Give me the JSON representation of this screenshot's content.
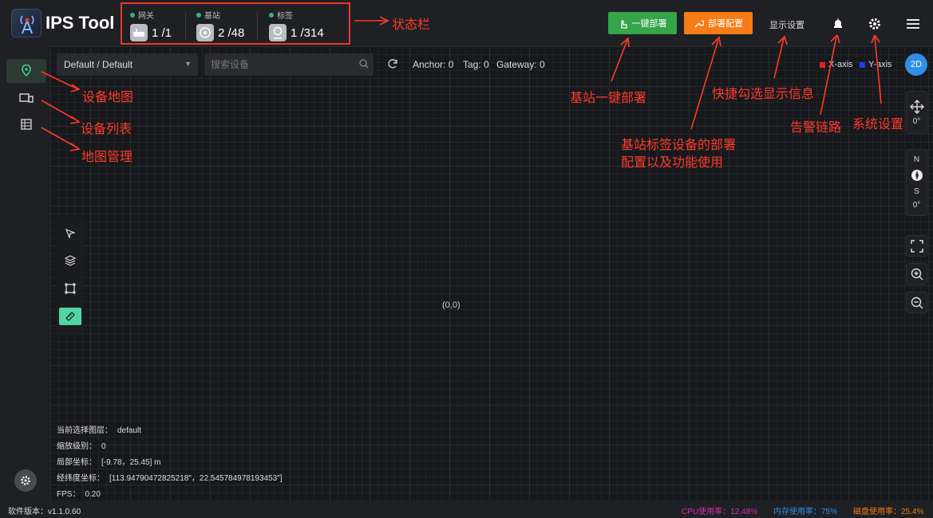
{
  "app": {
    "title": "IPS Tool"
  },
  "status": {
    "gateway": {
      "label": "网关",
      "value": "1 /1"
    },
    "anchor": {
      "label": "基站",
      "value": "2 /48"
    },
    "tag": {
      "label": "标签",
      "value": "1 /314"
    }
  },
  "toolbar": {
    "deploy_label": "一键部署",
    "config_label": "部署配置",
    "display_label": "显示设置",
    "icons": [
      "alarm-icon",
      "gear-icon",
      "menu-icon"
    ]
  },
  "annotations": {
    "status_bar": "状态栏",
    "device_map": "设备地图",
    "device_list": "设备列表",
    "map_manage": "地图管理",
    "one_click": "基站一键部署",
    "display": "快捷勾选显示信息",
    "config_line1": "基站标签设备的部署",
    "config_line2": "配置以及功能使用",
    "alarm": "告警链路",
    "system": "系统设置"
  },
  "filter": {
    "layer": "Default / Default",
    "search_placeholder": "搜索设备"
  },
  "counts": {
    "anchor": "Anchor: 0",
    "tag": "Tag: 0",
    "gateway": "Gateway: 0"
  },
  "axes": {
    "x_label": "X-axis",
    "x_color": "#e8231d",
    "y_label": "Y-axis",
    "y_color": "#1a3ff0",
    "mode": "2D"
  },
  "compass": {
    "rotate": "0°",
    "north": "N",
    "south": "S",
    "heading": "0°"
  },
  "canvas": {
    "origin": "(0,0)"
  },
  "info": {
    "layer_label": "当前选择图层：",
    "layer_value": "default",
    "zoom_label": "缩放级别：",
    "zoom_value": "0",
    "local_label": "局部坐标：",
    "local_value": "[-9.78，25.45] m",
    "geo_label": "经纬度坐标：",
    "geo_value": "[113.94790472825218\"，22.545784978193453\"]",
    "fps_label": "FPS：",
    "fps_value": "0.20"
  },
  "footer": {
    "version": "软件版本：v1.1.0.60",
    "cpu": "CPU使用率：12.48%",
    "cpu_color": "#d62fb2",
    "mem": "内存使用率：75%",
    "mem_color": "#2f8ee8",
    "disk": "磁盘使用率：25.4%",
    "disk_color": "#f57c16"
  }
}
